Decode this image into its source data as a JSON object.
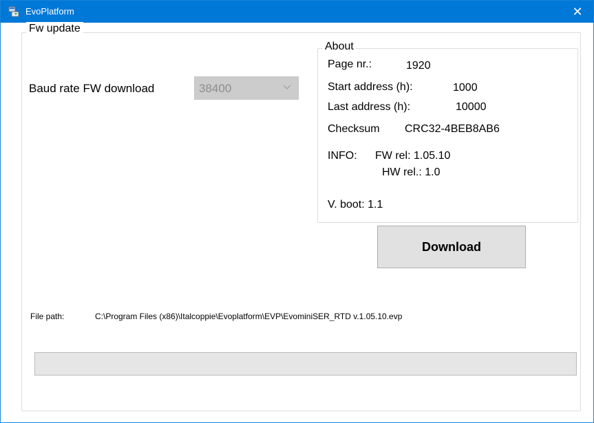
{
  "window": {
    "title": "EvoPlatform",
    "close_glyph": "✕",
    "icon": "app-icon"
  },
  "fw_update": {
    "legend": "Fw update",
    "baud_label": "Baud rate FW download",
    "baud_value": "38400",
    "baud_enabled": false
  },
  "about": {
    "legend": "About",
    "page_label": "Page nr.:",
    "page_value": "1920",
    "start_label": "Start address (h):",
    "start_value": "1000",
    "last_label": "Last address (h):",
    "last_value": "10000",
    "checksum_label": "Checksum",
    "checksum_value": "CRC32-4BEB8AB6",
    "info_label": "INFO:",
    "fw_rel": "FW rel: 1.05.10",
    "hw_rel": "HW rel.: 1.0",
    "vboot": "V. boot: 1.1"
  },
  "download_label": "Download",
  "file": {
    "label": "File path:",
    "path": "C:\\Program Files (x86)\\Italcoppie\\Evoplatform\\EVP\\EvominiSER_RTD v.1.05.10.evp"
  },
  "progress": {
    "value_percent": 0
  },
  "colors": {
    "titlebar": "#0078d7",
    "button_face": "#e1e1e1",
    "disabled_combo": "#cccccc"
  }
}
